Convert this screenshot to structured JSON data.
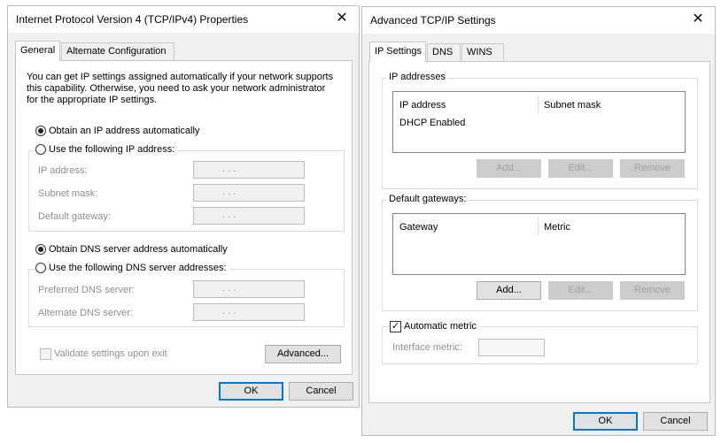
{
  "ipv4_dialog": {
    "title": "Internet Protocol Version 4 (TCP/IPv4) Properties",
    "close_glyph": "✕",
    "tabs": [
      "General",
      "Alternate Configuration"
    ],
    "description_lines": [
      "You can get IP settings assigned automatically if your network supports",
      "this capability. Otherwise, you need to ask your network administrator",
      "for the appropriate IP settings."
    ],
    "obtain_ip_auto": "Obtain an IP address automatically",
    "use_following_ip": "Use the following IP address:",
    "ip_address_label": "IP address:",
    "subnet_mask_label": "Subnet mask:",
    "default_gateway_label": "Default gateway:",
    "ip_field_dots": ".   .   .",
    "obtain_dns_auto": "Obtain DNS server address automatically",
    "use_following_dns": "Use the following DNS server addresses:",
    "preferred_dns_label": "Preferred DNS server:",
    "alternate_dns_label": "Alternate DNS server:",
    "validate_label": "Validate settings upon exit",
    "advanced_button": "Advanced...",
    "ok_button": "OK",
    "cancel_button": "Cancel"
  },
  "advanced_dialog": {
    "title": "Advanced TCP/IP Settings",
    "close_glyph": "✕",
    "tabs": [
      "IP Settings",
      "DNS",
      "WINS"
    ],
    "ip_addresses_group": "IP addresses",
    "ip_table_headers": [
      "IP address",
      "Subnet mask"
    ],
    "ip_table_rows": [
      "DHCP Enabled"
    ],
    "default_gateways_group": "Default gateways:",
    "gateway_table_headers": [
      "Gateway",
      "Metric"
    ],
    "add_button": "Add...",
    "edit_button": "Edit...",
    "remove_button": "Remove",
    "automatic_metric_label": "Automatic metric",
    "automatic_metric_checked": true,
    "interface_metric_label": "Interface metric:",
    "interface_metric_value": "",
    "ok_button": "OK",
    "cancel_button": "Cancel"
  },
  "colors": {
    "accent": "#0078d7",
    "window_bg": "#f0f0f0",
    "disabled_text": "#8f8f8f"
  }
}
